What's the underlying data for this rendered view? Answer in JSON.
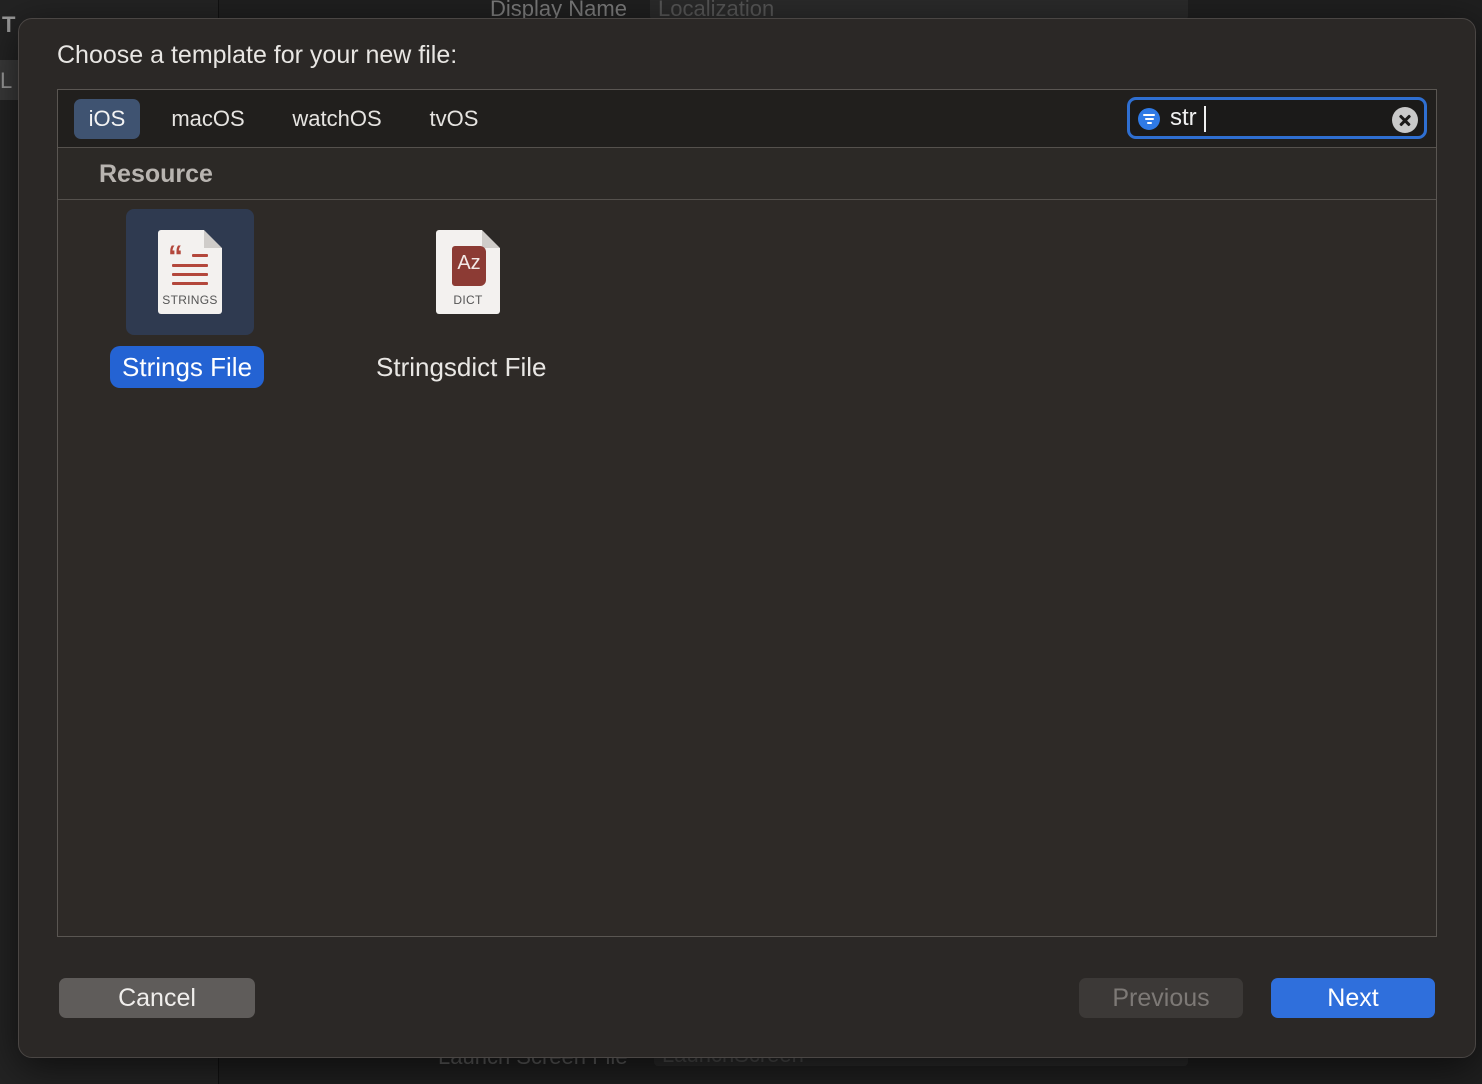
{
  "background": {
    "sidebar_letter_top": "T",
    "sidebar_letter_row": "L",
    "top_label": "Display Name",
    "top_field_value": "Localization",
    "bottom_label": "Launch Screen File",
    "bottom_field_value": "LaunchScreen"
  },
  "dialog": {
    "title": "Choose a template for your new file:",
    "platforms": [
      {
        "label": "iOS",
        "selected": true
      },
      {
        "label": "macOS",
        "selected": false
      },
      {
        "label": "watchOS",
        "selected": false
      },
      {
        "label": "tvOS",
        "selected": false
      }
    ],
    "search": {
      "value": "str",
      "placeholder": "Filter"
    },
    "section": "Resource",
    "templates": [
      {
        "label": "Strings File",
        "icon": "strings-file-icon",
        "icon_caption": "STRINGS",
        "selected": true
      },
      {
        "label": "Stringsdict File",
        "icon": "stringsdict-file-icon",
        "icon_caption": "DICT",
        "badge": "Az",
        "selected": false
      }
    ],
    "buttons": {
      "cancel": "Cancel",
      "previous": "Previous",
      "next": "Next"
    }
  },
  "colors": {
    "accent": "#2f6fdc",
    "selected_label": "#2463d3",
    "selected_tab": "#3f5371",
    "sheet_background": "#2b2826"
  }
}
